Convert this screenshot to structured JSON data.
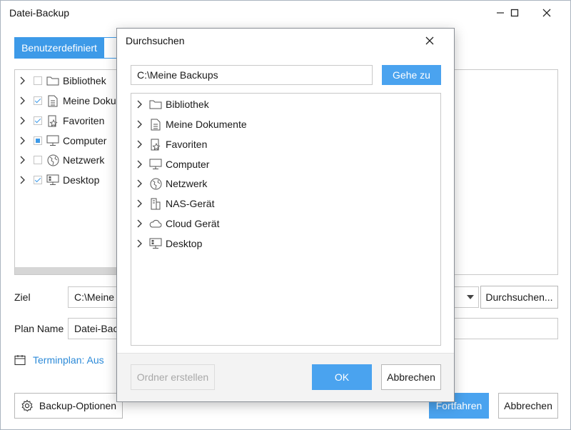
{
  "window": {
    "title": "Datei-Backup",
    "minimize_glyph": "─",
    "maximize_glyph": "☐",
    "close_glyph": "✕"
  },
  "tabs": [
    {
      "label": "Benutzerdefiniert",
      "active": true
    }
  ],
  "source_tree": {
    "items": [
      {
        "label": "Bibliothek",
        "check": "none",
        "icon": "folder-icon"
      },
      {
        "label": "Meine Dokun",
        "check": "checked",
        "icon": "document-icon"
      },
      {
        "label": "Favoriten",
        "check": "checked",
        "icon": "favorites-icon"
      },
      {
        "label": "Computer",
        "check": "partial",
        "icon": "computer-icon"
      },
      {
        "label": "Netzwerk",
        "check": "none",
        "icon": "network-icon"
      },
      {
        "label": "Desktop",
        "check": "checked",
        "icon": "desktop-icon"
      }
    ]
  },
  "target": {
    "label": "Ziel",
    "value": "C:\\Meine B",
    "browse_label": "Durchsuchen..."
  },
  "plan": {
    "label": "Plan Name",
    "value": "Datei-Back"
  },
  "schedule": {
    "label": "Terminplan: Aus"
  },
  "footer": {
    "options_label": "Backup-Optionen",
    "continue_label": "Fortfahren",
    "cancel_label": "Abbrechen"
  },
  "browse_dialog": {
    "title": "Durchsuchen",
    "close_glyph": "✕",
    "path_value": "C:\\Meine Backups",
    "goto_label": "Gehe zu",
    "tree": [
      {
        "label": "Bibliothek",
        "icon": "folder-icon"
      },
      {
        "label": "Meine Dokumente",
        "icon": "document-icon"
      },
      {
        "label": "Favoriten",
        "icon": "favorites-icon"
      },
      {
        "label": "Computer",
        "icon": "computer-icon"
      },
      {
        "label": "Netzwerk",
        "icon": "network-icon"
      },
      {
        "label": "NAS-Gerät",
        "icon": "nas-icon"
      },
      {
        "label": "Cloud Gerät",
        "icon": "cloud-icon"
      },
      {
        "label": "Desktop",
        "icon": "desktop-icon"
      }
    ],
    "new_folder_label": "Ordner erstellen",
    "ok_label": "OK",
    "cancel_label": "Abbrechen"
  },
  "colors": {
    "accent": "#3d9ae8",
    "button_blue": "#4aa3ef",
    "link": "#2c8ad8",
    "border": "#c8c8c8"
  }
}
